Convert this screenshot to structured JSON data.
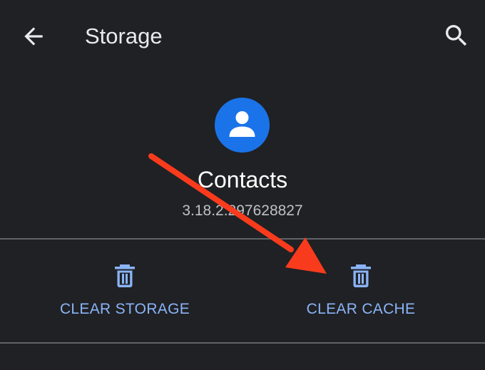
{
  "toolbar": {
    "title": "Storage",
    "back_icon": "arrow-back-icon",
    "search_icon": "search-icon"
  },
  "app": {
    "name": "Contacts",
    "version": "3.18.2.297628827",
    "icon": "person-icon",
    "icon_color": "#1a73e8"
  },
  "actions": {
    "clear_storage_label": "CLEAR STORAGE",
    "clear_cache_label": "CLEAR CACHE",
    "icon": "trash-icon",
    "accent_color": "#8ab4f8"
  },
  "annotation": {
    "arrow_color": "#f93b1d"
  }
}
